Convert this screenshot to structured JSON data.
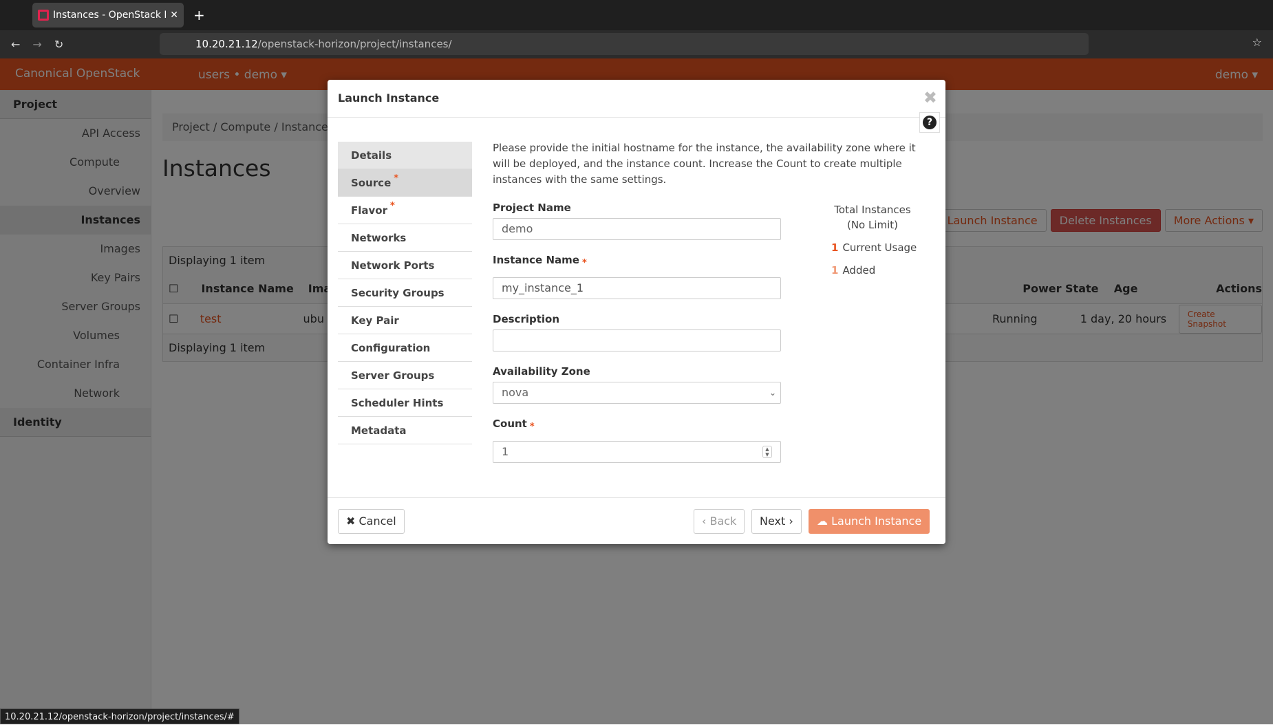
{
  "browser": {
    "tab_title": "Instances - OpenStack Da",
    "url_host": "10.20.21.12",
    "url_path": "/openstack-horizon/project/instances/",
    "status_url": "10.20.21.12/openstack-horizon/project/instances/#"
  },
  "header": {
    "brand": "Canonical OpenStack",
    "project": "users • demo ▾",
    "user": "demo ▾",
    "accent": "#E95420"
  },
  "sidebar": {
    "project": "Project",
    "items": [
      "API Access",
      "Compute",
      "Overview",
      "Instances",
      "Images",
      "Key Pairs",
      "Server Groups",
      "Volumes",
      "Container Infra",
      "Network"
    ],
    "identity": "Identity"
  },
  "main": {
    "breadcrumb": [
      "Project",
      "Compute",
      "Instances"
    ],
    "title": "Instances",
    "launch": "Launch Instance",
    "delete": "Delete Instances",
    "more": "More Actions ▾",
    "displaying": "Displaying 1 item",
    "columns": [
      "Instance Name",
      "Ima",
      "Power State",
      "Age",
      "Actions"
    ],
    "row": {
      "name": "test",
      "image": "ubu",
      "power": "Running",
      "age": "1 day, 20 hours",
      "action": "Create Snapshot"
    }
  },
  "modal": {
    "title": "Launch Instance",
    "nav": [
      {
        "label": "Details",
        "req": ""
      },
      {
        "label": "Source",
        "req": "*"
      },
      {
        "label": "Flavor",
        "req": "*"
      },
      {
        "label": "Networks",
        "req": ""
      },
      {
        "label": "Network Ports",
        "req": ""
      },
      {
        "label": "Security Groups",
        "req": ""
      },
      {
        "label": "Key Pair",
        "req": ""
      },
      {
        "label": "Configuration",
        "req": ""
      },
      {
        "label": "Server Groups",
        "req": ""
      },
      {
        "label": "Scheduler Hints",
        "req": ""
      },
      {
        "label": "Metadata",
        "req": ""
      }
    ],
    "description": "Please provide the initial hostname for the instance, the availability zone where it will be deployed, and the instance count. Increase the Count to create multiple instances with the same settings.",
    "project_name_label": "Project Name",
    "project_name": "demo",
    "instance_name_label": "Instance Name",
    "instance_name": "my_instance_1",
    "description_label": "Description",
    "description_value": "",
    "az_label": "Availability Zone",
    "az": "nova",
    "count_label": "Count",
    "count": "1",
    "quota": {
      "title": "Total Instances",
      "limit": "(No Limit)",
      "current": "1",
      "current_label": "Current Usage",
      "added": "1",
      "added_label": "Added"
    },
    "cancel": "Cancel",
    "back": "‹ Back",
    "next": "Next ›",
    "launch": "Launch Instance"
  }
}
